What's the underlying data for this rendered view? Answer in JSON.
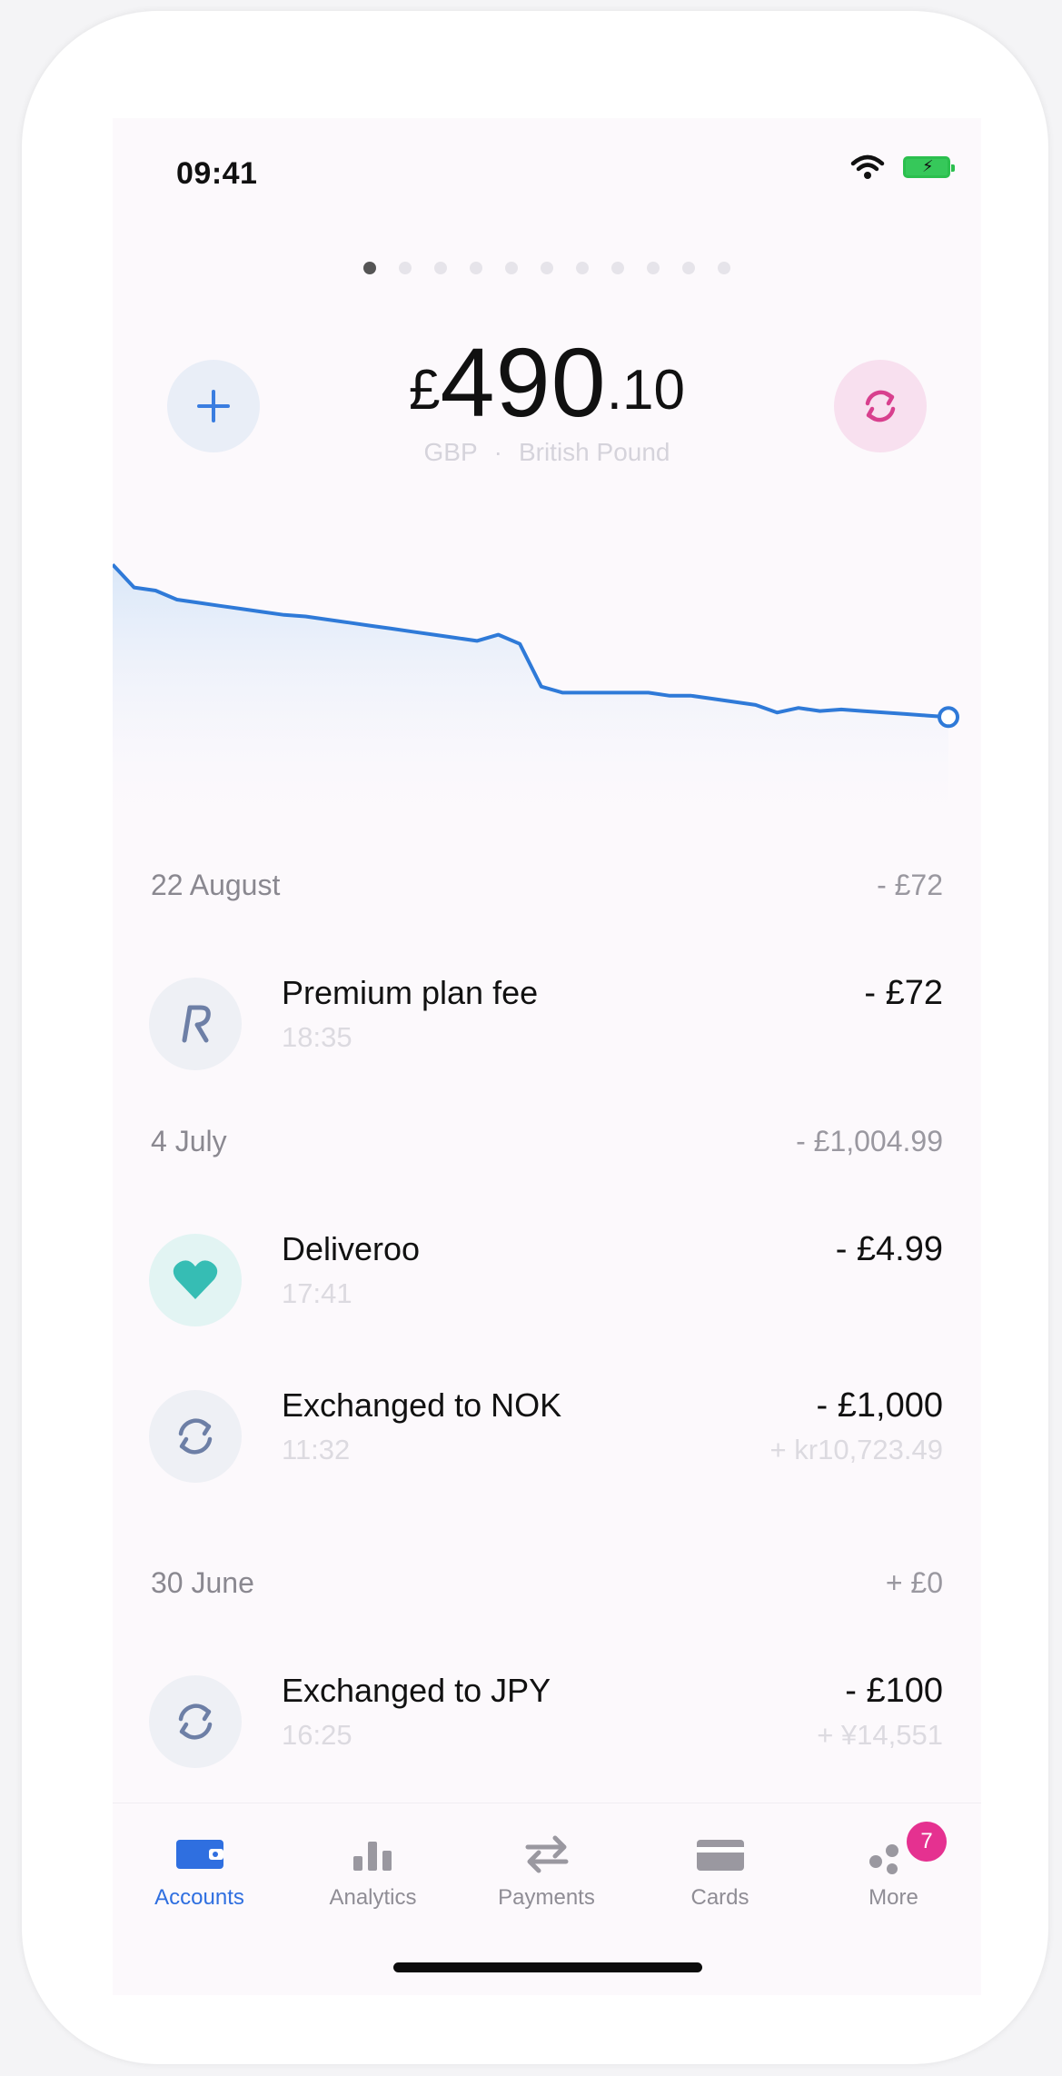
{
  "status_bar": {
    "time": "09:41"
  },
  "page_indicator": {
    "count": 11,
    "active_index": 0
  },
  "balance": {
    "currency_symbol": "£",
    "major": "490",
    "minor": ".10",
    "currency_code": "GBP",
    "separator": "·",
    "currency_name": "British Pound"
  },
  "chart_data": {
    "type": "line",
    "series": [
      {
        "values": [
          520,
          505,
          503,
          497,
          495,
          493,
          491,
          489,
          487,
          486,
          484,
          482,
          480,
          478,
          476,
          474,
          472,
          470,
          474,
          468,
          440,
          436,
          436,
          436,
          436,
          436,
          434,
          434,
          432,
          430,
          428,
          423,
          426,
          424,
          425,
          424,
          423,
          422,
          421,
          420
        ]
      }
    ],
    "accent_color": "#2f7ad8"
  },
  "transactions": [
    {
      "date": "22 August",
      "total": "- £72",
      "items": [
        {
          "name": "Premium plan fee",
          "time": "18:35",
          "amount": "- £72",
          "sub": "",
          "icon": "revolut-r-icon"
        }
      ]
    },
    {
      "date": "4 July",
      "total": "- £1,004.99",
      "items": [
        {
          "name": "Deliveroo",
          "time": "17:41",
          "amount": "- £4.99",
          "sub": "",
          "icon": "heart-icon"
        },
        {
          "name": "Exchanged to NOK",
          "time": "11:32",
          "amount": "- £1,000",
          "sub": "+ kr10,723.49",
          "icon": "exchange-arrows-icon"
        }
      ]
    },
    {
      "date": "30 June",
      "total": "+ £0",
      "items": [
        {
          "name": "Exchanged to JPY",
          "time": "16:25",
          "amount": "- £100",
          "sub": "+ ¥14,551",
          "icon": "exchange-arrows-icon"
        }
      ]
    }
  ],
  "tab_bar": {
    "tabs": [
      {
        "label": "Accounts",
        "icon": "wallet-icon",
        "active": true
      },
      {
        "label": "Analytics",
        "icon": "bar-chart-icon",
        "active": false
      },
      {
        "label": "Payments",
        "icon": "transfer-arrows-icon",
        "active": false
      },
      {
        "label": "Cards",
        "icon": "card-icon",
        "active": false
      },
      {
        "label": "More",
        "icon": "more-dots-icon",
        "active": false,
        "badge": "7"
      }
    ]
  },
  "colors": {
    "accent_blue": "#2f6fe0",
    "accent_pink": "#e53190",
    "teal": "#36bdb4",
    "background": "#fcf9fc"
  }
}
